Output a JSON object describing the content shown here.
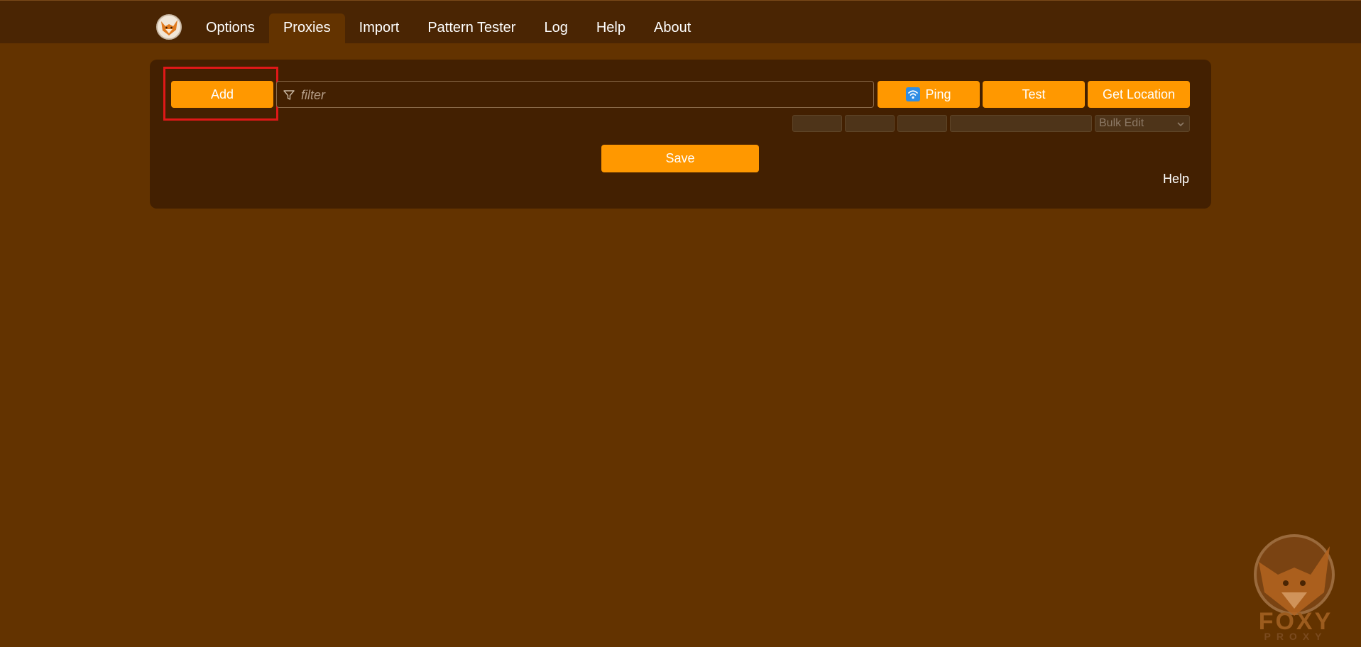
{
  "nav": {
    "items": [
      {
        "label": "Options"
      },
      {
        "label": "Proxies",
        "active": true
      },
      {
        "label": "Import"
      },
      {
        "label": "Pattern Tester"
      },
      {
        "label": "Log"
      },
      {
        "label": "Help"
      },
      {
        "label": "About"
      }
    ]
  },
  "toolbar": {
    "add_label": "Add",
    "filter_placeholder": "filter",
    "filter_icon": "funnel-icon",
    "ping_label": "Ping",
    "ping_icon": "wifi-icon",
    "test_label": "Test",
    "get_location_label": "Get Location",
    "bulk_edit_label": "Bulk Edit"
  },
  "save_label": "Save",
  "help_label": "Help",
  "watermark": {
    "line1": "FOXY",
    "line2": "PROXY"
  },
  "colors": {
    "background": "#633300",
    "topbar": "#4a2503",
    "panel": "#432001",
    "accent": "#ff9800",
    "highlight": "#e01818"
  }
}
